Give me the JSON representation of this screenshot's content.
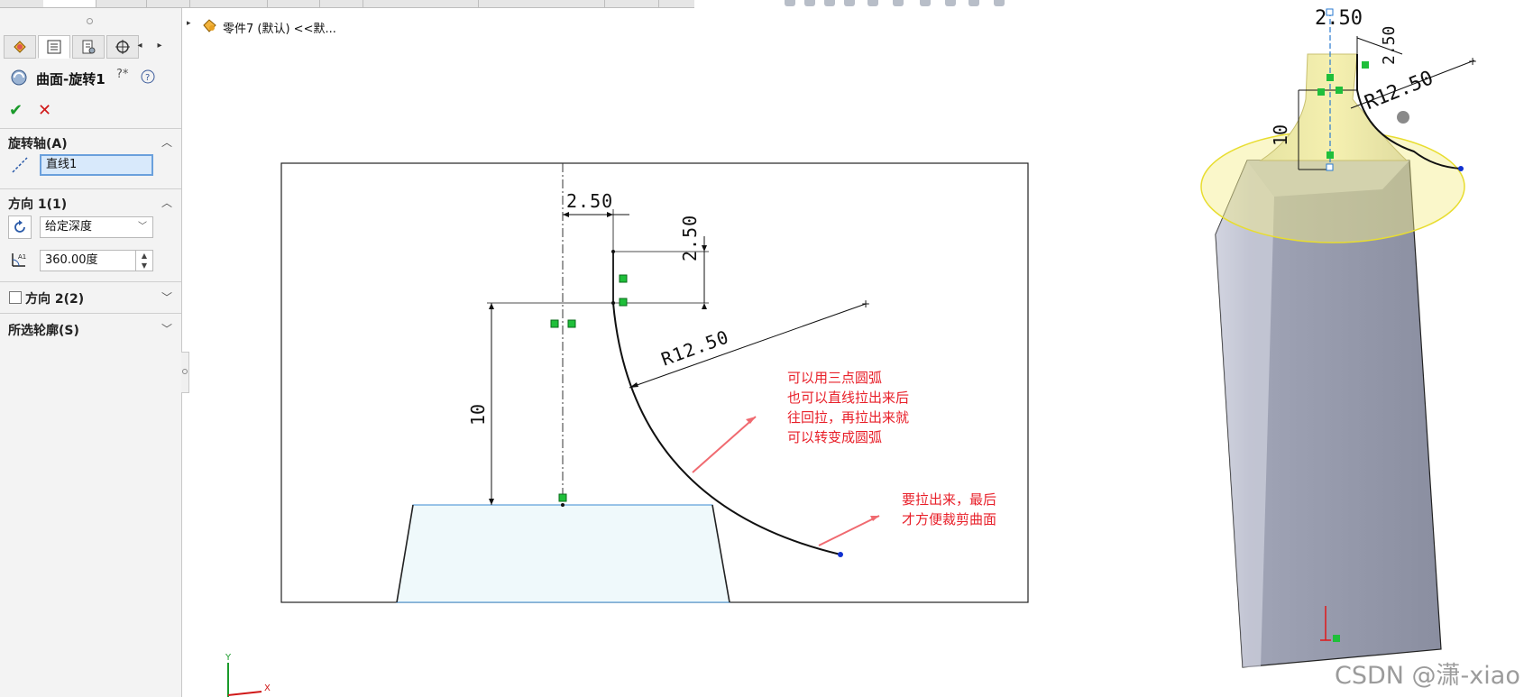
{
  "tree": {
    "part_label": "零件7 (默认) <<默..."
  },
  "panel": {
    "feature_title": "曲面-旋转1",
    "ok_label": "✔",
    "cancel_label": "✕",
    "axis_section": {
      "title": "旋转轴(A)",
      "axis_value": "直线1"
    },
    "dir1_section": {
      "title": "方向 1(1)",
      "end_condition": "给定深度",
      "angle_value": "360.00度"
    },
    "dir2_section": {
      "title": "方向 2(2)",
      "checked": false
    },
    "contour_section": {
      "title": "所选轮廓(S)"
    }
  },
  "sketch": {
    "dim_top": "2.50",
    "dim_side": "2.50",
    "dim_radius": "R12.50",
    "dim_height": "10"
  },
  "annotations": {
    "note1": [
      "可以用三点圆弧",
      "也可以直线拉出来后",
      "往回拉，再拉出来就",
      "可以转变成圆弧"
    ],
    "note2": [
      "要拉出来，最后",
      "才方便裁剪曲面"
    ]
  },
  "preview": {
    "dim_top": "2.50",
    "dim_radius": "R12.50",
    "dim_side": "2.50",
    "dim_height": "10"
  },
  "triad": {
    "x_label": "X",
    "y_label": "Y"
  },
  "watermark": "CSDN @潇-xiao",
  "colors": {
    "note_red": "#e8202a",
    "selection_blue": "#d8e9fb",
    "preview_yellow": "#f4ee8a",
    "body_gray": "#8e92a3",
    "constraint_green": "#1fbf3a"
  }
}
